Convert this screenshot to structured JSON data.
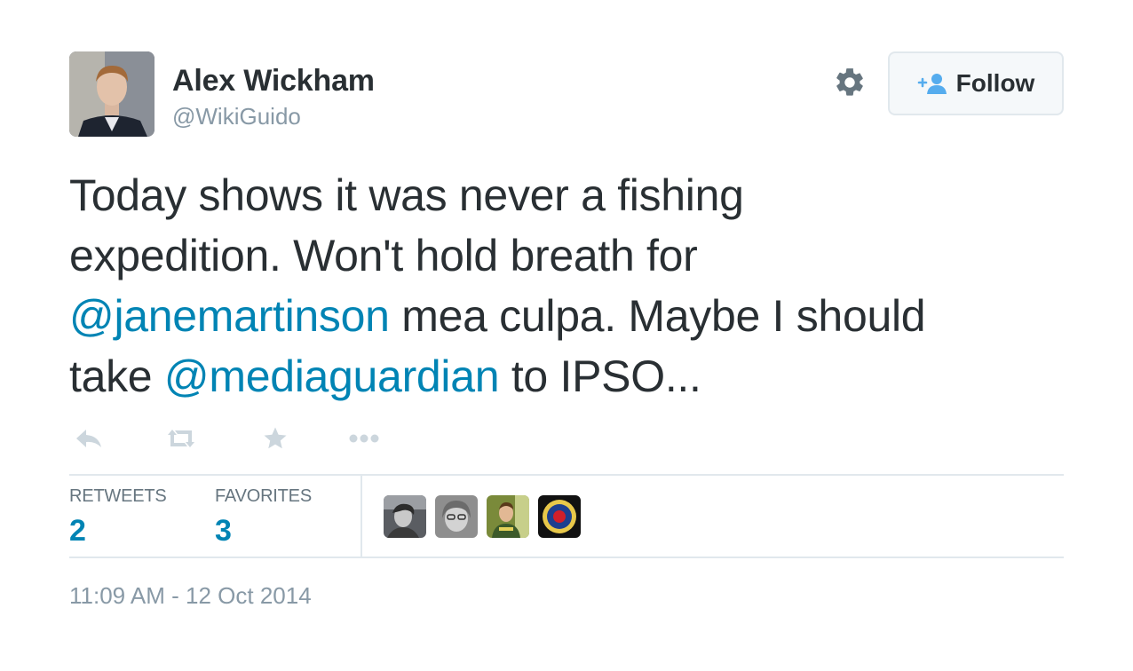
{
  "author": {
    "name": "Alex Wickham",
    "handle": "@WikiGuido",
    "avatar_icon": "user-photo"
  },
  "header": {
    "settings_icon": "gear-icon",
    "follow_label": "Follow",
    "follow_icon": "add-user-icon"
  },
  "tweet": {
    "line1": "Today shows it was never a fishing",
    "line2": "expedition. Won't hold breath for",
    "mention1": "@janemartinson",
    "line3_rest": " mea culpa. Maybe I should",
    "line4_start": "take ",
    "mention2": "@mediaguardian",
    "line4_end": " to IPSO..."
  },
  "actions": [
    "reply-icon",
    "retweet-icon",
    "favorite-icon",
    "more-icon"
  ],
  "stats": {
    "retweets_label": "RETWEETS",
    "retweets_value": "2",
    "favorites_label": "FAVORITES",
    "favorites_value": "3"
  },
  "favoriters": [
    "favoriter-avatar-1",
    "favoriter-avatar-2",
    "favoriter-avatar-3",
    "roundel-avatar"
  ],
  "timestamp": "11:09 AM - 12 Oct 2014",
  "colors": {
    "link": "#0084b4",
    "text": "#292f33",
    "muted": "#8899a6",
    "border": "#e1e8ed"
  }
}
